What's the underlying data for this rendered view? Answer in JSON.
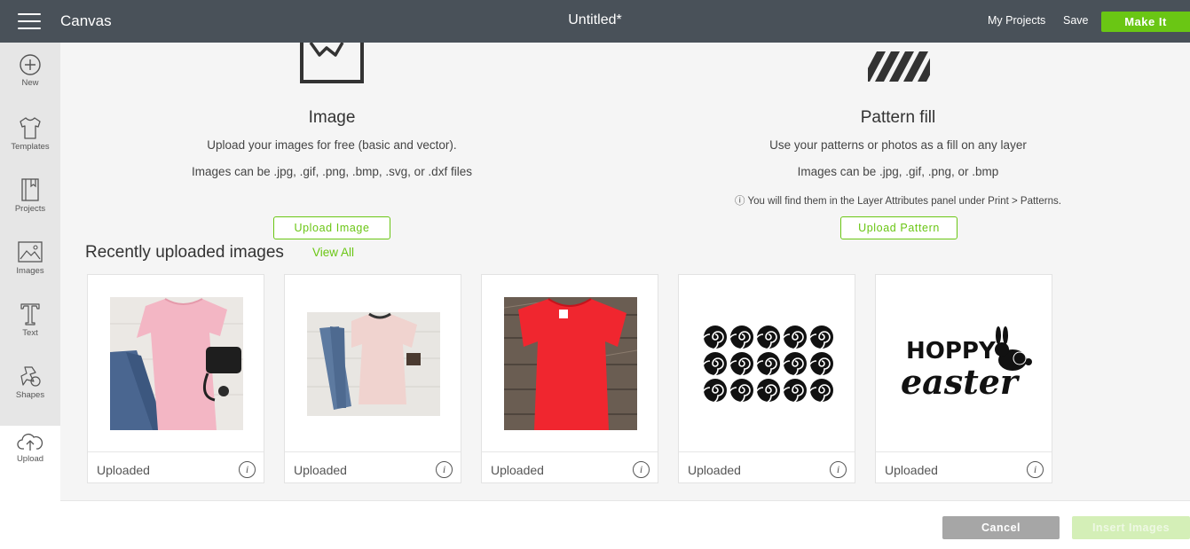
{
  "header": {
    "app_name": "Canvas",
    "document_title": "Untitled*",
    "my_projects": "My Projects",
    "save": "Save",
    "make_it": "Make It"
  },
  "sidebar": {
    "items": [
      {
        "label": "New",
        "icon": "plus-circle-icon"
      },
      {
        "label": "Templates",
        "icon": "tshirt-icon"
      },
      {
        "label": "Projects",
        "icon": "notebook-icon"
      },
      {
        "label": "Images",
        "icon": "image-icon"
      },
      {
        "label": "Text",
        "icon": "text-t-icon"
      },
      {
        "label": "Shapes",
        "icon": "shapes-icon"
      },
      {
        "label": "Upload",
        "icon": "cloud-upload-icon"
      }
    ],
    "active": "Upload"
  },
  "image_section": {
    "title": "Image",
    "description": "Upload your images for free (basic and vector).",
    "formats": "Images can be .jpg, .gif, .png, .bmp, .svg, or .dxf files",
    "button": "Upload Image"
  },
  "pattern_section": {
    "title": "Pattern fill",
    "description": "Use your patterns or photos as a fill on any layer",
    "formats": "Images can be .jpg, .gif, .png, or .bmp",
    "note": "ⓘ You will find them in the Layer Attributes panel under Print > Patterns.",
    "button": "Upload Pattern"
  },
  "recent": {
    "title": "Recently uploaded images",
    "view_all": "View All",
    "cards": [
      {
        "label": "Uploaded",
        "thumbnail": "pink-tshirt-jeans-photo"
      },
      {
        "label": "Uploaded",
        "thumbnail": "pale-pink-tshirt-flatlay-photo"
      },
      {
        "label": "Uploaded",
        "thumbnail": "red-tshirt-wood-photo"
      },
      {
        "label": "Uploaded",
        "thumbnail": "rolled-flowers-svg"
      },
      {
        "label": "Uploaded",
        "thumbnail": "hoppy-easter-svg",
        "thumbnail_text": [
          "HOPPY",
          "easter"
        ]
      }
    ]
  },
  "footer": {
    "cancel": "Cancel",
    "insert": "Insert Images"
  },
  "colors": {
    "topbar": "#495159",
    "accent_green": "#6ac614",
    "sidebar_bg": "#e6e6e6",
    "cancel_gray": "#a6a6a6",
    "insert_disabled": "#d4efb7"
  }
}
